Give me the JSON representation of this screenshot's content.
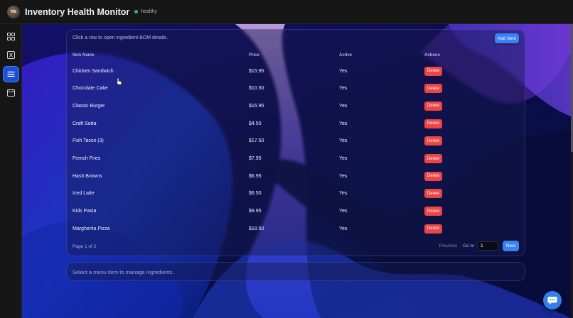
{
  "app": {
    "logo_text": "PSI",
    "title": "Inventory Health Monitor",
    "status": "healthy",
    "status_color": "#22c55e"
  },
  "sidebar": {
    "items": [
      {
        "icon": "dashboard-grid-icon",
        "active": false
      },
      {
        "icon": "inventory-box-icon",
        "active": false
      },
      {
        "icon": "menu-list-icon",
        "active": true
      },
      {
        "icon": "calendar-icon",
        "active": false
      }
    ]
  },
  "menu_table": {
    "hint": "Click a row to open ingredient BOM details.",
    "add_label": "Add Item",
    "columns": [
      "Item Name",
      "Price",
      "Active",
      "Actions"
    ],
    "rows": [
      {
        "name": "Chicken Sandwich",
        "price": "$15.95",
        "active": "Yes",
        "action": "Delete"
      },
      {
        "name": "Chocolate Cake",
        "price": "$10.50",
        "active": "Yes",
        "action": "Delete"
      },
      {
        "name": "Classic Burger",
        "price": "$16.95",
        "active": "Yes",
        "action": "Delete"
      },
      {
        "name": "Craft Soda",
        "price": "$4.50",
        "active": "Yes",
        "action": "Delete"
      },
      {
        "name": "Fish Tacos (3)",
        "price": "$17.50",
        "active": "Yes",
        "action": "Delete"
      },
      {
        "name": "French Fries",
        "price": "$7.95",
        "active": "Yes",
        "action": "Delete"
      },
      {
        "name": "Hash Browns",
        "price": "$6.95",
        "active": "Yes",
        "action": "Delete"
      },
      {
        "name": "Iced Latte",
        "price": "$6.50",
        "active": "Yes",
        "action": "Delete"
      },
      {
        "name": "Kids Pasta",
        "price": "$9.95",
        "active": "Yes",
        "action": "Delete"
      },
      {
        "name": "Margherita Pizza",
        "price": "$18.50",
        "active": "Yes",
        "action": "Delete"
      }
    ],
    "pagination": {
      "page_info": "Page 1 of 2",
      "previous_label": "Previous",
      "goto_label": "Go to",
      "goto_value": "1",
      "next_label": "Next"
    }
  },
  "bom_panel": {
    "placeholder_text": "Select a menu item to manage ingredients."
  },
  "colors": {
    "accent": "#3b82f6",
    "danger": "#ef4444"
  }
}
